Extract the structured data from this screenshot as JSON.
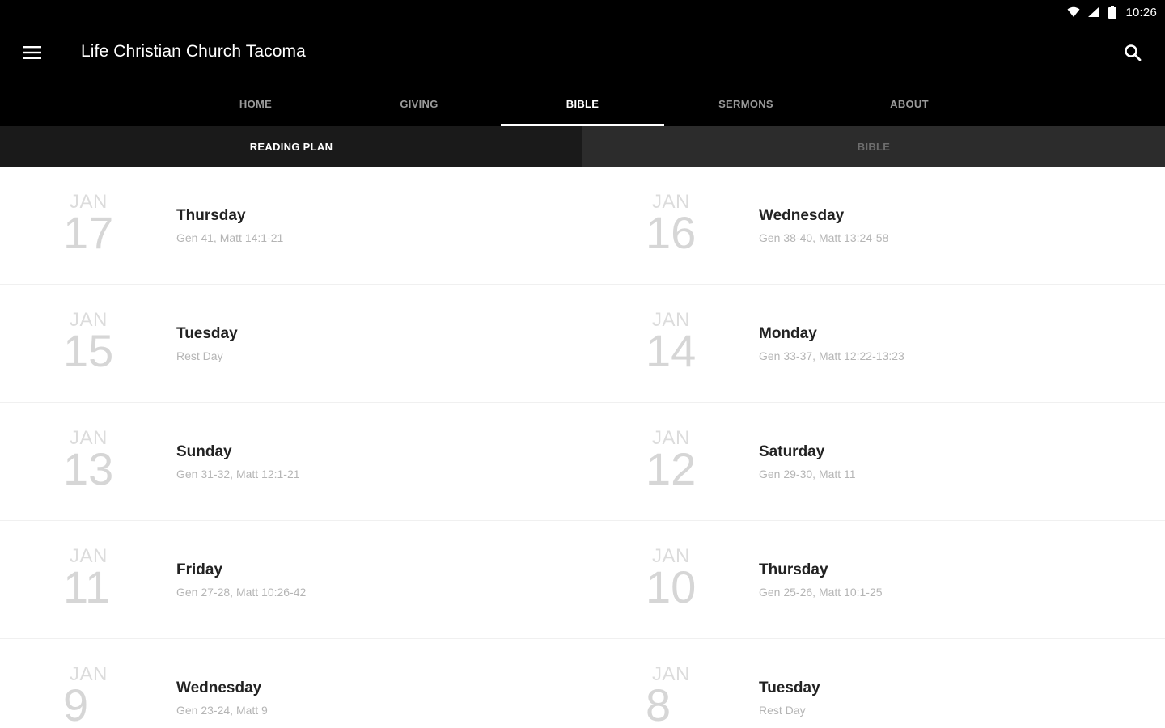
{
  "status_bar": {
    "time": "10:26"
  },
  "app_bar": {
    "title": "Life Christian Church Tacoma",
    "menu_icon": "hamburger-menu-icon",
    "search_icon": "search-icon"
  },
  "tabs": [
    {
      "label": "HOME",
      "active": false
    },
    {
      "label": "GIVING",
      "active": false
    },
    {
      "label": "BIBLE",
      "active": true
    },
    {
      "label": "SERMONS",
      "active": false
    },
    {
      "label": "ABOUT",
      "active": false
    }
  ],
  "subtabs": [
    {
      "label": "READING PLAN",
      "active": true
    },
    {
      "label": "BIBLE",
      "active": false
    }
  ],
  "entries": [
    {
      "month": "JAN",
      "day": "17",
      "weekday": "Thursday",
      "reading": "Gen 41, Matt 14:1-21"
    },
    {
      "month": "JAN",
      "day": "16",
      "weekday": "Wednesday",
      "reading": "Gen 38-40, Matt 13:24-58"
    },
    {
      "month": "JAN",
      "day": "15",
      "weekday": "Tuesday",
      "reading": "Rest Day"
    },
    {
      "month": "JAN",
      "day": "14",
      "weekday": "Monday",
      "reading": "Gen 33-37, Matt 12:22-13:23"
    },
    {
      "month": "JAN",
      "day": "13",
      "weekday": "Sunday",
      "reading": "Gen 31-32, Matt 12:1-21"
    },
    {
      "month": "JAN",
      "day": "12",
      "weekday": "Saturday",
      "reading": "Gen 29-30, Matt 11"
    },
    {
      "month": "JAN",
      "day": "11",
      "weekday": "Friday",
      "reading": "Gen 27-28, Matt 10:26-42"
    },
    {
      "month": "JAN",
      "day": "10",
      "weekday": "Thursday",
      "reading": "Gen 25-26, Matt 10:1-25"
    },
    {
      "month": "JAN",
      "day": "9",
      "weekday": "Wednesday",
      "reading": "Gen 23-24, Matt 9"
    },
    {
      "month": "JAN",
      "day": "8",
      "weekday": "Tuesday",
      "reading": "Rest Day"
    }
  ]
}
